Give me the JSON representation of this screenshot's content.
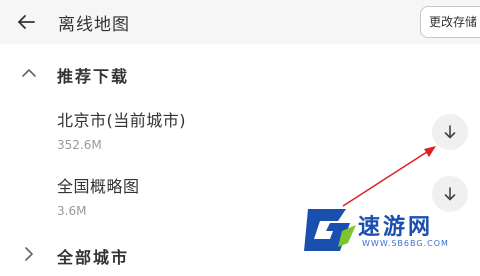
{
  "header": {
    "title": "离线地图",
    "change_storage_label": "更改存储"
  },
  "recommended": {
    "title": "推荐下载",
    "items": [
      {
        "name": "北京市(当前城市)",
        "size": "352.6M"
      },
      {
        "name": "全国概略图",
        "size": "3.6M"
      }
    ]
  },
  "all_cities": {
    "label": "全部城市"
  },
  "watermark": {
    "text": "速游网",
    "url": "WWW.SB6BG.COM"
  },
  "colors": {
    "topbar_bg": "#f6f6f6",
    "accent_red": "#e02020",
    "watermark_blue": "#1a4fb0",
    "watermark_green": "#7cc52c"
  },
  "icons": {
    "back": "arrow-left-icon",
    "section": "chevron-up-icon",
    "download": "arrow-down-icon",
    "all_cities": "chevron-right-icon"
  }
}
